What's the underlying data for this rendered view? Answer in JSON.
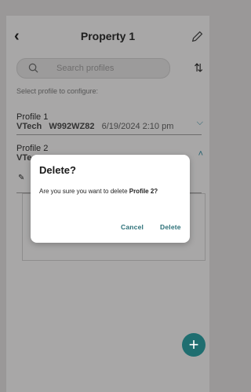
{
  "header": {
    "title": "Property 1",
    "back_icon": "back-icon",
    "edit_icon": "pencil-icon"
  },
  "search": {
    "placeholder": "Search profiles"
  },
  "sort_icon": "sort-icon",
  "hint": "Select profile to configure:",
  "profiles": [
    {
      "name": "Profile 1",
      "brand": "VTech",
      "model": "W992WZ82",
      "date": "6/19/2024",
      "time": "2:10 pm",
      "expanded": false
    },
    {
      "name": "Profile 2",
      "brand": "VTe",
      "expanded": true
    }
  ],
  "dialog": {
    "title": "Delete?",
    "message_prefix": "Are you sure you want to delete ",
    "message_bold": "Profile 2?",
    "cancel_label": "Cancel",
    "delete_label": "Delete"
  },
  "fab": {
    "label": "+"
  },
  "colors": {
    "accent": "#1f6e70",
    "dialog_bg": "#ffffff",
    "overlay": "#9a9898"
  }
}
